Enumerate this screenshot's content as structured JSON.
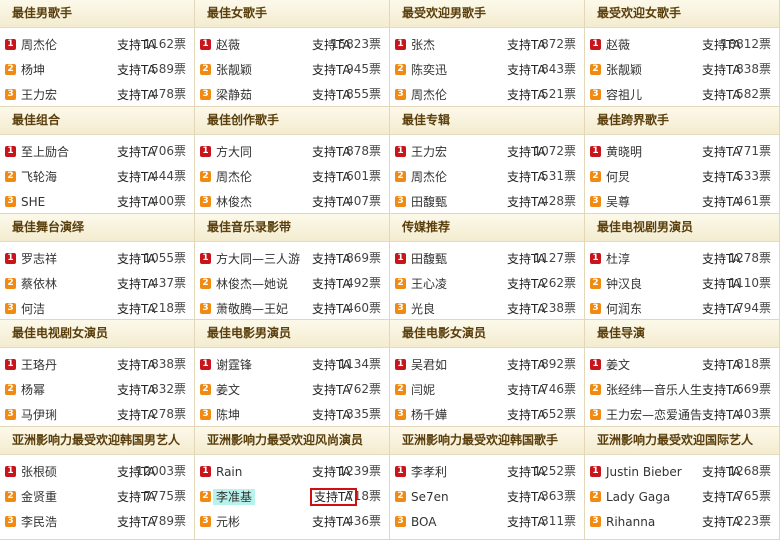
{
  "vote_label": "支持TA",
  "categories": [
    {
      "title": "最佳男歌手",
      "entries": [
        {
          "rank": "1",
          "name": "周杰伦",
          "votes": "1162票"
        },
        {
          "rank": "2",
          "name": "杨坤",
          "votes": "589票"
        },
        {
          "rank": "3",
          "name": "王力宏",
          "votes": "478票"
        }
      ]
    },
    {
      "title": "最佳女歌手",
      "entries": [
        {
          "rank": "1",
          "name": "赵薇",
          "votes": "15823票"
        },
        {
          "rank": "2",
          "name": "张靓颖",
          "votes": "945票"
        },
        {
          "rank": "3",
          "name": "梁静茹",
          "votes": "855票"
        }
      ]
    },
    {
      "title": "最受欢迎男歌手",
      "entries": [
        {
          "rank": "1",
          "name": "张杰",
          "votes": "872票"
        },
        {
          "rank": "2",
          "name": "陈奕迅",
          "votes": "843票"
        },
        {
          "rank": "3",
          "name": "周杰伦",
          "votes": "521票"
        }
      ]
    },
    {
      "title": "最受欢迎女歌手",
      "entries": [
        {
          "rank": "1",
          "name": "赵薇",
          "votes": "18812票"
        },
        {
          "rank": "2",
          "name": "张靓颖",
          "votes": "838票"
        },
        {
          "rank": "3",
          "name": "容祖儿",
          "votes": "582票"
        }
      ]
    },
    {
      "title": "最佳组合",
      "entries": [
        {
          "rank": "1",
          "name": "至上励合",
          "votes": "706票"
        },
        {
          "rank": "2",
          "name": "飞轮海",
          "votes": "444票"
        },
        {
          "rank": "3",
          "name": "SHE",
          "votes": "400票"
        }
      ]
    },
    {
      "title": "最佳创作歌手",
      "entries": [
        {
          "rank": "1",
          "name": "方大同",
          "votes": "878票"
        },
        {
          "rank": "2",
          "name": "周杰伦",
          "votes": "601票"
        },
        {
          "rank": "3",
          "name": "林俊杰",
          "votes": "407票"
        }
      ]
    },
    {
      "title": "最佳专辑",
      "entries": [
        {
          "rank": "1",
          "name": "王力宏",
          "votes": "1072票"
        },
        {
          "rank": "2",
          "name": "周杰伦",
          "votes": "531票"
        },
        {
          "rank": "3",
          "name": "田馥甄",
          "votes": "428票"
        }
      ]
    },
    {
      "title": "最佳跨界歌手",
      "entries": [
        {
          "rank": "1",
          "name": "黄晓明",
          "votes": "771票"
        },
        {
          "rank": "2",
          "name": "何炅",
          "votes": "533票"
        },
        {
          "rank": "3",
          "name": "吴尊",
          "votes": "461票"
        }
      ]
    },
    {
      "title": "最佳舞台演绎",
      "entries": [
        {
          "rank": "1",
          "name": "罗志祥",
          "votes": "1055票"
        },
        {
          "rank": "2",
          "name": "蔡依林",
          "votes": "437票"
        },
        {
          "rank": "3",
          "name": "何洁",
          "votes": "218票"
        }
      ]
    },
    {
      "title": "最佳音乐录影带",
      "entries": [
        {
          "rank": "1",
          "name": "方大同—三人游",
          "votes": "869票"
        },
        {
          "rank": "2",
          "name": "林俊杰—她说",
          "votes": "492票"
        },
        {
          "rank": "3",
          "name": "萧敬腾—王妃",
          "votes": "460票"
        }
      ]
    },
    {
      "title": "传媒推荐",
      "entries": [
        {
          "rank": "1",
          "name": "田馥甄",
          "votes": "1127票"
        },
        {
          "rank": "2",
          "name": "王心凌",
          "votes": "262票"
        },
        {
          "rank": "3",
          "name": "光良",
          "votes": "238票"
        }
      ]
    },
    {
      "title": "最佳电视剧男演员",
      "entries": [
        {
          "rank": "1",
          "name": "杜淳",
          "votes": "1278票"
        },
        {
          "rank": "2",
          "name": "钟汉良",
          "votes": "1110票"
        },
        {
          "rank": "3",
          "name": "何润东",
          "votes": "794票"
        }
      ]
    },
    {
      "title": "最佳电视剧女演员",
      "entries": [
        {
          "rank": "1",
          "name": "王珞丹",
          "votes": "838票"
        },
        {
          "rank": "2",
          "name": "杨幂",
          "votes": "832票"
        },
        {
          "rank": "3",
          "name": "马伊琍",
          "votes": "278票"
        }
      ]
    },
    {
      "title": "最佳电影男演员",
      "entries": [
        {
          "rank": "1",
          "name": "谢霆锋",
          "votes": "1134票"
        },
        {
          "rank": "2",
          "name": "姜文",
          "votes": "762票"
        },
        {
          "rank": "3",
          "name": "陈坤",
          "votes": "335票"
        }
      ]
    },
    {
      "title": "最佳电影女演员",
      "entries": [
        {
          "rank": "1",
          "name": "吴君如",
          "votes": "892票"
        },
        {
          "rank": "2",
          "name": "闫妮",
          "votes": "746票"
        },
        {
          "rank": "3",
          "name": "杨千嬅",
          "votes": "652票"
        }
      ]
    },
    {
      "title": "最佳导演",
      "entries": [
        {
          "rank": "1",
          "name": "姜文",
          "votes": "818票"
        },
        {
          "rank": "2",
          "name": "张经纬—音乐人生",
          "votes": "669票"
        },
        {
          "rank": "3",
          "name": "王力宏—恋爱通告",
          "votes": "403票"
        }
      ]
    },
    {
      "title": "亚洲影响力最受欢迎韩国男艺人",
      "entries": [
        {
          "rank": "1",
          "name": "张根硕",
          "votes": "12003票"
        },
        {
          "rank": "2",
          "name": "金贤重",
          "votes": "7775票"
        },
        {
          "rank": "3",
          "name": "李民浩",
          "votes": "789票"
        }
      ]
    },
    {
      "title": "亚洲影响力最受欢迎风尚演员",
      "entries": [
        {
          "rank": "1",
          "name": "Rain",
          "votes": "1239票"
        },
        {
          "rank": "2",
          "name": "李准基",
          "votes": "718票",
          "highlighted": true,
          "vote_selected": true
        },
        {
          "rank": "3",
          "name": "元彬",
          "votes": "436票"
        }
      ]
    },
    {
      "title": "亚洲影响力最受欢迎韩国歌手",
      "entries": [
        {
          "rank": "1",
          "name": "李孝利",
          "votes": "1252票"
        },
        {
          "rank": "2",
          "name": "Se7en",
          "votes": "363票"
        },
        {
          "rank": "3",
          "name": "BOA",
          "votes": "311票"
        }
      ]
    },
    {
      "title": "亚洲影响力最受欢迎国际艺人",
      "entries": [
        {
          "rank": "1",
          "name": "Justin Bieber",
          "votes": "1268票"
        },
        {
          "rank": "2",
          "name": "Lady Gaga",
          "votes": "765票"
        },
        {
          "rank": "3",
          "name": "Rihanna",
          "votes": "223票"
        }
      ]
    }
  ]
}
